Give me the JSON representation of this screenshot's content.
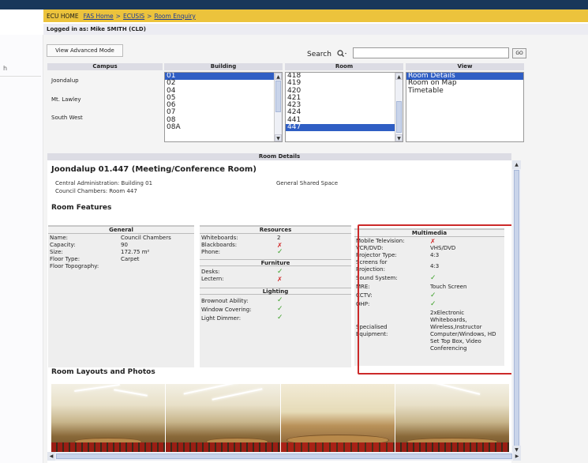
{
  "breadcrumb": {
    "home": "ECU HOME",
    "links": [
      "FAS Home",
      "ECUSIS",
      "Room Enquiry"
    ],
    "separator": ">"
  },
  "login": "Logged in as: Mike SMITH (CLD)",
  "left_panel": {
    "letter": "h"
  },
  "toolbar": {
    "advanced_mode": "View Advanced Mode",
    "search_label": "Search",
    "search_value": "",
    "go_label": "GO"
  },
  "selectors": {
    "campus_header": "Campus",
    "building_header": "Building",
    "room_header": "Room",
    "view_header": "View",
    "campuses": [
      "Joondalup",
      "Mt. Lawley",
      "South West"
    ],
    "buildings": [
      "01",
      "02",
      "04",
      "05",
      "06",
      "07",
      "08",
      "08A"
    ],
    "buildings_selected": "01",
    "rooms": [
      "418",
      "419",
      "420",
      "421",
      "423",
      "424",
      "441",
      "447"
    ],
    "rooms_selected": "447",
    "views": [
      "Room Details",
      "Room on Map",
      "Timetable"
    ],
    "views_selected": "Room Details"
  },
  "details": {
    "header": "Room Details",
    "title": "Joondalup 01.447 (Meeting/Conference Room)",
    "line1": "Central Administration: Building 01",
    "line2": "Council Chambers: Room 447",
    "space_type": "General Shared Space",
    "features_heading": "Room Features",
    "general": {
      "heading": "General",
      "rows": [
        {
          "k": "Name:",
          "v": "Council Chambers"
        },
        {
          "k": "Capacity:",
          "v": "90"
        },
        {
          "k": "Size:",
          "v": "172.75 m²"
        },
        {
          "k": "Floor Type:",
          "v": "Carpet"
        },
        {
          "k": "Floor Topography:",
          "v": ""
        }
      ]
    },
    "resources": {
      "heading": "Resources",
      "rows": [
        {
          "k": "Whiteboards:",
          "v": "2"
        },
        {
          "k": "Blackboards:",
          "v": "✗"
        },
        {
          "k": "Phone:",
          "v": "✓"
        }
      ]
    },
    "furniture": {
      "heading": "Furniture",
      "rows": [
        {
          "k": "Desks:",
          "v": "✓"
        },
        {
          "k": "Lectern:",
          "v": "✗"
        }
      ]
    },
    "lighting": {
      "heading": "Lighting",
      "rows": [
        {
          "k": "Brownout Ability:",
          "v": "✓"
        },
        {
          "k": "Window Covering:",
          "v": "✓"
        },
        {
          "k": "Light Dimmer:",
          "v": "✓"
        }
      ]
    },
    "multimedia": {
      "heading": "Multimedia",
      "rows": [
        {
          "k": "Mobile Television:",
          "v": "✗"
        },
        {
          "k": "VCR/DVD:",
          "v": "VHS/DVD"
        },
        {
          "k": "Projector Type:",
          "v": "4:3"
        },
        {
          "k": "Screens for Projection:",
          "v": "4:3"
        },
        {
          "k": "Sound System:",
          "v": "✓"
        },
        {
          "k": "MRE:",
          "v": "Touch Screen"
        },
        {
          "k": "CCTV:",
          "v": "✓"
        },
        {
          "k": "OHP:",
          "v": "✓"
        },
        {
          "k": "Specialised Equipment:",
          "v": "2xElectronic Whiteboards, Wireless,Instructor Computer/Windows, HD Set Top Box, Video Conferencing"
        }
      ]
    },
    "layouts_heading": "Room Layouts and Photos"
  },
  "colors": {
    "top_bar": "#18375a",
    "breadcrumb_bar": "#ecc33c",
    "selection": "#2f5ec4",
    "check": "#3ca028",
    "cross": "#d02020",
    "highlight_box": "#cc2a2a"
  }
}
